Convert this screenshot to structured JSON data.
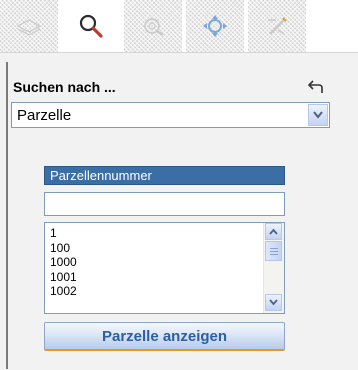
{
  "tabs": [
    {
      "name": "layers-tab",
      "icon": "layers-icon",
      "active": false
    },
    {
      "name": "search-tab",
      "icon": "search-icon",
      "active": true
    },
    {
      "name": "identify-tab",
      "icon": "identify-icon",
      "active": false
    },
    {
      "name": "navigate-tab",
      "icon": "move-icon",
      "active": false
    },
    {
      "name": "tools-tab",
      "icon": "tools-icon",
      "active": false
    }
  ],
  "search": {
    "heading": "Suchen nach ...",
    "type_value": "Parzelle",
    "field_label": "Parzellennummer",
    "input_value": "",
    "list_items": [
      "1",
      "100",
      "1000",
      "1001",
      "1002"
    ],
    "submit_label": "Parzelle anzeigen"
  },
  "colors": {
    "accent_header": "#3a6ea5",
    "button_text": "#2d5fa0",
    "button_underline": "#e39a22",
    "search_icon_handle": "#c0392b"
  }
}
